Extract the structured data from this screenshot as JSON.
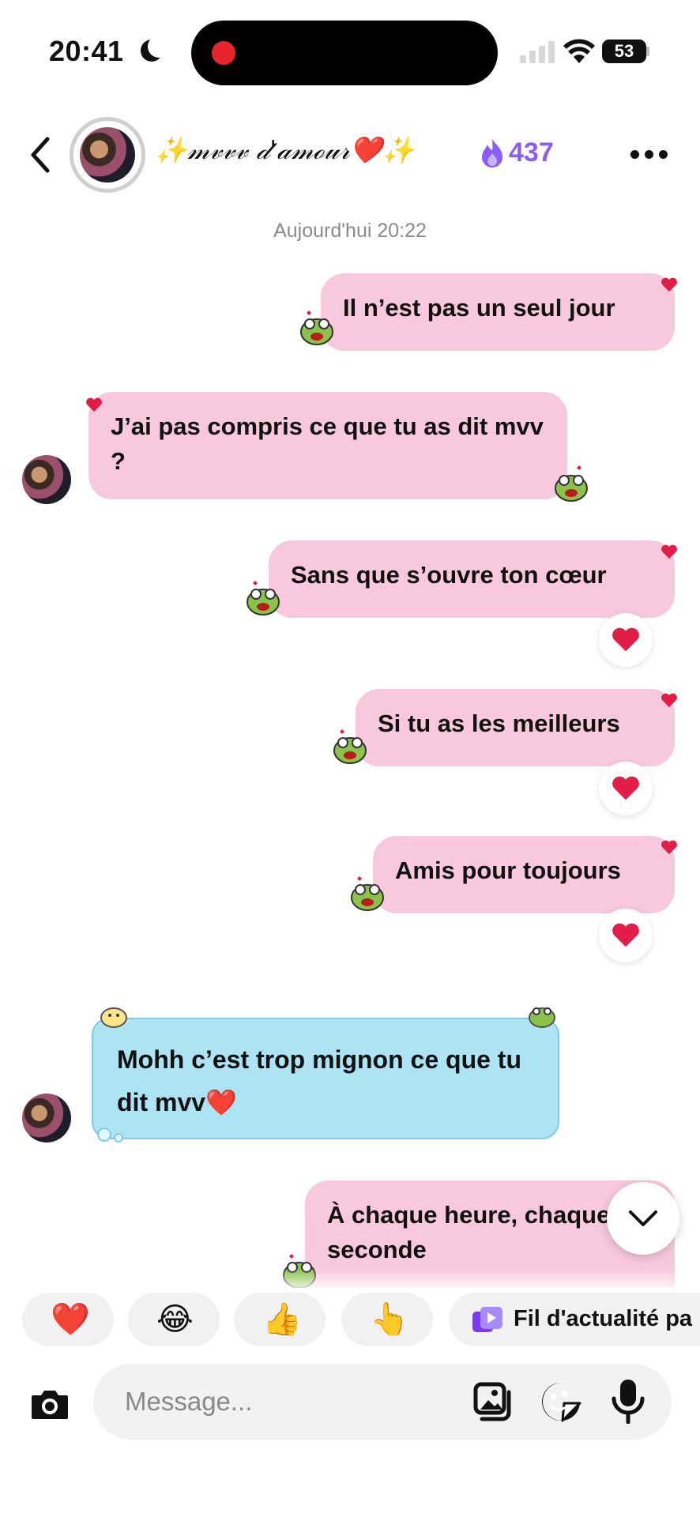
{
  "status_bar": {
    "time": "20:41",
    "battery": "53"
  },
  "header": {
    "title": "✨𝓂𝓋𝓋𝓋 𝒹'𝒶𝓂ℴ𝓊𝓇❤️✨",
    "streak_count": "437",
    "streak_color": "#8b5cf6"
  },
  "conversation": {
    "date_stamp": "Aujourd'hui 20:22",
    "messages": [
      {
        "text": "Il n’est pas un seul jour",
        "from": "me"
      },
      {
        "text": "J’ai pas compris ce que tu as dit mvv ?",
        "from": "them"
      },
      {
        "text": "Sans que s’ouvre ton cœur",
        "from": "me",
        "reaction": "❤️"
      },
      {
        "text": "Si tu as les meilleurs",
        "from": "me",
        "reaction": "❤️"
      },
      {
        "text": "Amis pour toujours",
        "from": "me",
        "reaction": "❤️"
      },
      {
        "text": "Mohh c’est trop mignon ce que tu dit mvv❤️",
        "from": "them"
      },
      {
        "text": "À chaque heure, chaque seconde",
        "from": "me"
      }
    ],
    "bubble_color_me": "#f8c8dc",
    "bubble_color_them_special": "#aee3f3"
  },
  "quick_reactions": {
    "items": [
      "❤️",
      "😂",
      "👍",
      "👆"
    ],
    "feed_label": "Fil d'actualité pa"
  },
  "composer": {
    "placeholder": "Message..."
  }
}
